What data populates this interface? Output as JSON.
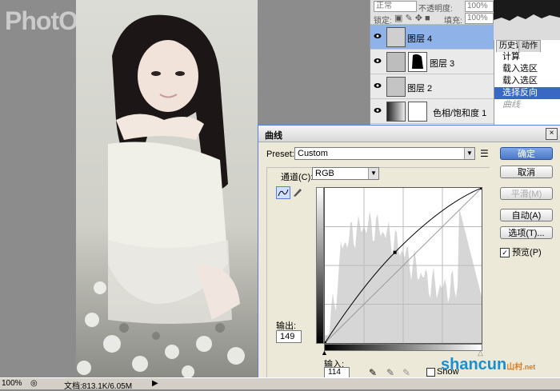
{
  "watermark": "PhotOPS",
  "status": {
    "zoom": "100%",
    "doc_size": "文档:813.1K/6.05M"
  },
  "options_bar": {
    "blend_mode": "正常",
    "opacity_label": "不透明度:",
    "opacity_value": "100%",
    "lock_label": "锁定:",
    "fill_label": "填充:",
    "fill_value": "100%"
  },
  "layers": [
    {
      "name": "图层 4",
      "selected": true
    },
    {
      "name": "图层 3",
      "selected": false
    },
    {
      "name": "图层 2",
      "selected": false
    },
    {
      "name": "色相/饱和度 1",
      "selected": false
    }
  ],
  "actions_panel": {
    "tabs": [
      "历史记录",
      "动作"
    ],
    "items": [
      {
        "label": "计算",
        "selected": false
      },
      {
        "label": "载入选区",
        "selected": false
      },
      {
        "label": "载入选区",
        "selected": false
      },
      {
        "label": "选择反向",
        "selected": true
      },
      {
        "label": "曲线",
        "selected": false
      }
    ]
  },
  "curves": {
    "title": "曲线",
    "close": "×",
    "preset_label": "Preset:",
    "preset_value": "Custom",
    "channel_label": "通道(C):",
    "channel_value": "RGB",
    "output_label": "输出:",
    "output_value": "149",
    "input_label": "输入:",
    "input_value": "114",
    "show_clipping_label": "Show",
    "buttons": {
      "ok": "确定",
      "cancel": "取消",
      "smooth": "平滑(M)",
      "auto": "自动(A)",
      "options": "选项(T)...",
      "preview": "预览(P)"
    },
    "preview_checked": true,
    "control_point": {
      "input": 114,
      "output": 149
    }
  },
  "site_watermark": {
    "main": "shancun",
    "sub": "山村",
    "tld": ".net"
  }
}
